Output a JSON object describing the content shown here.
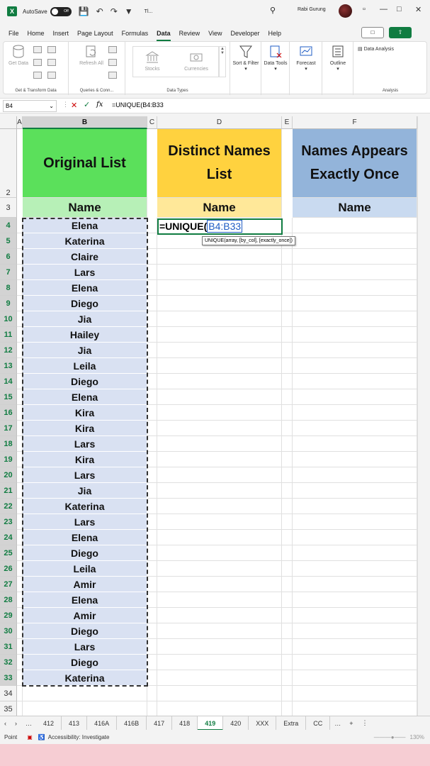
{
  "titlebar": {
    "app_icon": "X",
    "autosave_label": "AutoSave",
    "autosave_state": "Off",
    "file_name": "Tl...",
    "user_name": "Rabi Gurung"
  },
  "menu": [
    "File",
    "Home",
    "Insert",
    "Page Layout",
    "Formulas",
    "Data",
    "Review",
    "View",
    "Developer",
    "Help"
  ],
  "menu_active": "Data",
  "ribbon": {
    "get_data": "Get Data",
    "group1": "Get & Transform Data",
    "refresh_all": "Refresh All",
    "group2": "Queries & Conn...",
    "stocks": "Stocks",
    "currencies": "Currencies",
    "group3": "Data Types",
    "sort_filter": "Sort & Filter",
    "data_tools": "Data Tools",
    "forecast": "Forecast",
    "outline": "Outline",
    "data_analysis": "Data Analysis",
    "group4": "Analysis"
  },
  "formula_bar": {
    "name_box": "B4",
    "fx": "fx",
    "formula": "=UNIQUE(B4:B33"
  },
  "columns": [
    "A",
    "B",
    "C",
    "D",
    "E",
    "F"
  ],
  "row_numbers": [
    "2",
    "3",
    "4",
    "5",
    "6",
    "7",
    "8",
    "9",
    "10",
    "11",
    "12",
    "13",
    "14",
    "15",
    "16",
    "17",
    "18",
    "19",
    "20",
    "21",
    "22",
    "23",
    "24",
    "25",
    "26",
    "27",
    "28",
    "29",
    "30",
    "31",
    "32",
    "33",
    "34",
    "35"
  ],
  "headers": {
    "original": "Original List",
    "distinct": "Distinct Names List",
    "once": "Names Appears Exactly Once",
    "name_b": "Name",
    "name_d": "Name",
    "name_f": "Name"
  },
  "names": [
    "Elena",
    "Katerina",
    "Claire",
    "Lars",
    "Elena",
    "Diego",
    "Jia",
    "Hailey",
    "Jia",
    "Leila",
    "Diego",
    "Elena",
    "Kira",
    "Kira",
    "Lars",
    "Kira",
    "Lars",
    "Jia",
    "Katerina",
    "Lars",
    "Elena",
    "Diego",
    "Leila",
    "Amir",
    "Elena",
    "Amir",
    "Diego",
    "Lars",
    "Diego",
    "Katerina"
  ],
  "edit_cell": {
    "prefix": "=UNIQUE(",
    "ref": "B4:B33"
  },
  "tooltip": "UNIQUE(array, [by_col], [exactly_once])",
  "sheet_tabs": [
    "412",
    "413",
    "416A",
    "416B",
    "417",
    "418",
    "419",
    "420",
    "XXX",
    "Extra",
    "CC"
  ],
  "active_tab": "419",
  "status": {
    "mode": "Point",
    "accessibility": "Accessibility: Investigate",
    "zoom": "130%"
  },
  "colors": {
    "header_green": "#5be05b",
    "header_yellow": "#ffd23f",
    "header_blue": "#93b4da",
    "sub_green": "#b7f0b7",
    "sub_yellow": "#ffe899",
    "sub_blue": "#c9daf0",
    "excel_green": "#107c41"
  }
}
